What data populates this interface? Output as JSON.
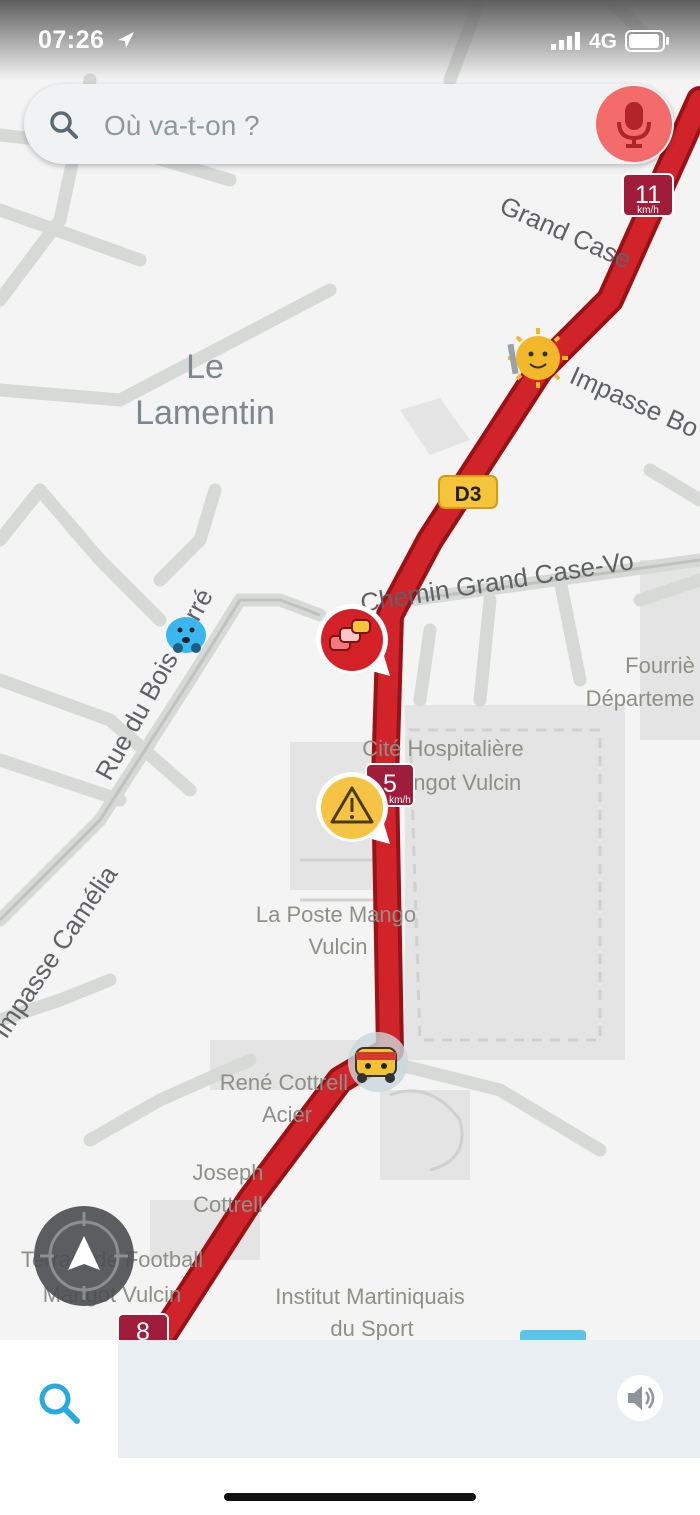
{
  "status_bar": {
    "time": "07:26",
    "network": "4G"
  },
  "search": {
    "placeholder": "Où va-t-on ?"
  },
  "map": {
    "place_names": {
      "le": "Le",
      "lamentin": "Lamentin",
      "fourriere_1": "Fourriè",
      "fourriere_2": "Départeme",
      "cite_1": "Cité Hospitalière",
      "cite_2": "Mangot Vulcin",
      "poste_1": "La Poste Mango",
      "poste_2": "Vulcin",
      "rene_1": "René Cottrell",
      "rene_2": "Acier",
      "joseph_1": "Joseph",
      "joseph_2": "Cottrell",
      "terrain_1": "Terrain de Football",
      "terrain_2": "Mangot Vulcin",
      "institut_1": "Institut Martiniquais",
      "institut_2": "du Sport"
    },
    "street_names": {
      "grand_case": "Grand Case",
      "impasse_bo": "Impasse Bo",
      "chemin": "Chemin Grand Case-Vo",
      "rue_bois": "Rue du Bois Carré",
      "impasse_camelia": "Impasse Camélia"
    },
    "road_badge": "D3",
    "speed_markers": {
      "top": "11",
      "top_unit": "km/h",
      "middle": "5",
      "middle_unit": "km/h",
      "bottom": "8"
    },
    "colors": {
      "route": "#d0232a",
      "route_edge": "#9a1116",
      "road": "#d7d9d7",
      "background": "#f4f4f4"
    }
  },
  "icons": {
    "status_location": "location-arrow-icon",
    "search": "search-icon",
    "mic": "microphone-icon",
    "traffic": "traffic-jam-icon",
    "hazard": "hazard-warning-icon",
    "wazer_blue": "wazer-avatar-icon",
    "wazer_sun": "wazer-sun-icon",
    "ninja": "ninja-wazer-icon",
    "recenter": "recenter-compass-icon",
    "sound": "sound-icon"
  },
  "accent_colors": {
    "mic": "#f36b6b",
    "search_icon": "#29a9e0",
    "hazard": "#f6c445"
  }
}
